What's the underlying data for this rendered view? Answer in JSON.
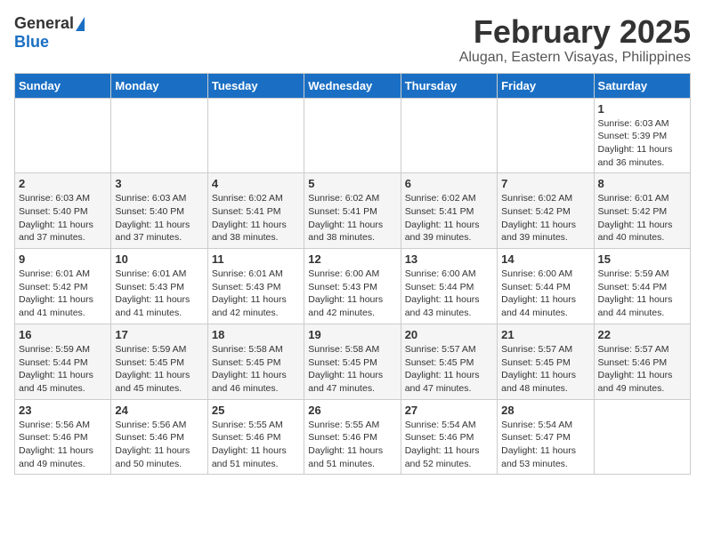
{
  "header": {
    "logo_general": "General",
    "logo_blue": "Blue",
    "title": "February 2025",
    "subtitle": "Alugan, Eastern Visayas, Philippines"
  },
  "weekdays": [
    "Sunday",
    "Monday",
    "Tuesday",
    "Wednesday",
    "Thursday",
    "Friday",
    "Saturday"
  ],
  "weeks": [
    [
      {
        "day": "",
        "info": ""
      },
      {
        "day": "",
        "info": ""
      },
      {
        "day": "",
        "info": ""
      },
      {
        "day": "",
        "info": ""
      },
      {
        "day": "",
        "info": ""
      },
      {
        "day": "",
        "info": ""
      },
      {
        "day": "1",
        "info": "Sunrise: 6:03 AM\nSunset: 5:39 PM\nDaylight: 11 hours\nand 36 minutes."
      }
    ],
    [
      {
        "day": "2",
        "info": "Sunrise: 6:03 AM\nSunset: 5:40 PM\nDaylight: 11 hours\nand 37 minutes."
      },
      {
        "day": "3",
        "info": "Sunrise: 6:03 AM\nSunset: 5:40 PM\nDaylight: 11 hours\nand 37 minutes."
      },
      {
        "day": "4",
        "info": "Sunrise: 6:02 AM\nSunset: 5:41 PM\nDaylight: 11 hours\nand 38 minutes."
      },
      {
        "day": "5",
        "info": "Sunrise: 6:02 AM\nSunset: 5:41 PM\nDaylight: 11 hours\nand 38 minutes."
      },
      {
        "day": "6",
        "info": "Sunrise: 6:02 AM\nSunset: 5:41 PM\nDaylight: 11 hours\nand 39 minutes."
      },
      {
        "day": "7",
        "info": "Sunrise: 6:02 AM\nSunset: 5:42 PM\nDaylight: 11 hours\nand 39 minutes."
      },
      {
        "day": "8",
        "info": "Sunrise: 6:01 AM\nSunset: 5:42 PM\nDaylight: 11 hours\nand 40 minutes."
      }
    ],
    [
      {
        "day": "9",
        "info": "Sunrise: 6:01 AM\nSunset: 5:42 PM\nDaylight: 11 hours\nand 41 minutes."
      },
      {
        "day": "10",
        "info": "Sunrise: 6:01 AM\nSunset: 5:43 PM\nDaylight: 11 hours\nand 41 minutes."
      },
      {
        "day": "11",
        "info": "Sunrise: 6:01 AM\nSunset: 5:43 PM\nDaylight: 11 hours\nand 42 minutes."
      },
      {
        "day": "12",
        "info": "Sunrise: 6:00 AM\nSunset: 5:43 PM\nDaylight: 11 hours\nand 42 minutes."
      },
      {
        "day": "13",
        "info": "Sunrise: 6:00 AM\nSunset: 5:44 PM\nDaylight: 11 hours\nand 43 minutes."
      },
      {
        "day": "14",
        "info": "Sunrise: 6:00 AM\nSunset: 5:44 PM\nDaylight: 11 hours\nand 44 minutes."
      },
      {
        "day": "15",
        "info": "Sunrise: 5:59 AM\nSunset: 5:44 PM\nDaylight: 11 hours\nand 44 minutes."
      }
    ],
    [
      {
        "day": "16",
        "info": "Sunrise: 5:59 AM\nSunset: 5:44 PM\nDaylight: 11 hours\nand 45 minutes."
      },
      {
        "day": "17",
        "info": "Sunrise: 5:59 AM\nSunset: 5:45 PM\nDaylight: 11 hours\nand 45 minutes."
      },
      {
        "day": "18",
        "info": "Sunrise: 5:58 AM\nSunset: 5:45 PM\nDaylight: 11 hours\nand 46 minutes."
      },
      {
        "day": "19",
        "info": "Sunrise: 5:58 AM\nSunset: 5:45 PM\nDaylight: 11 hours\nand 47 minutes."
      },
      {
        "day": "20",
        "info": "Sunrise: 5:57 AM\nSunset: 5:45 PM\nDaylight: 11 hours\nand 47 minutes."
      },
      {
        "day": "21",
        "info": "Sunrise: 5:57 AM\nSunset: 5:45 PM\nDaylight: 11 hours\nand 48 minutes."
      },
      {
        "day": "22",
        "info": "Sunrise: 5:57 AM\nSunset: 5:46 PM\nDaylight: 11 hours\nand 49 minutes."
      }
    ],
    [
      {
        "day": "23",
        "info": "Sunrise: 5:56 AM\nSunset: 5:46 PM\nDaylight: 11 hours\nand 49 minutes."
      },
      {
        "day": "24",
        "info": "Sunrise: 5:56 AM\nSunset: 5:46 PM\nDaylight: 11 hours\nand 50 minutes."
      },
      {
        "day": "25",
        "info": "Sunrise: 5:55 AM\nSunset: 5:46 PM\nDaylight: 11 hours\nand 51 minutes."
      },
      {
        "day": "26",
        "info": "Sunrise: 5:55 AM\nSunset: 5:46 PM\nDaylight: 11 hours\nand 51 minutes."
      },
      {
        "day": "27",
        "info": "Sunrise: 5:54 AM\nSunset: 5:46 PM\nDaylight: 11 hours\nand 52 minutes."
      },
      {
        "day": "28",
        "info": "Sunrise: 5:54 AM\nSunset: 5:47 PM\nDaylight: 11 hours\nand 53 minutes."
      },
      {
        "day": "",
        "info": ""
      }
    ]
  ]
}
